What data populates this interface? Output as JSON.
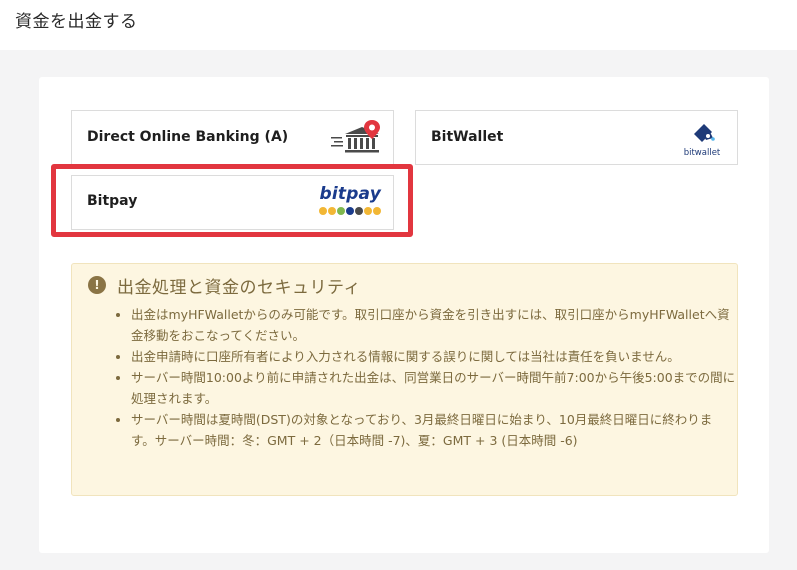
{
  "page": {
    "title": "資金を出金する"
  },
  "methods": [
    {
      "label": "Direct Online Banking (A)",
      "logo": "bank-building-pin-icon"
    },
    {
      "label": "BitWallet",
      "logo": "bitwallet-logo",
      "logo_text": "bitwallet"
    },
    {
      "label": "Bitpay",
      "logo": "bitpay-logo",
      "logo_text": "bitpay",
      "highlighted": true
    }
  ],
  "notice": {
    "title": "出金処理と資金のセキュリティ",
    "items": [
      "出金はmyHFWalletからのみ可能です。取引口座から資金を引き出すには、取引口座からmyHFWalletへ資金移動をおこなってください。",
      "出金申請時に口座所有者により入力される情報に関する誤りに関しては当社は責任を負いません。",
      "サーバー時間10:00より前に申請された出金は、同営業日のサーバー時間午前7:00から午後5:00までの間に処理されます。",
      "サーバー時間は夏時間(DST)の対象となっており、3月最終日曜日に始まり、10月最終日曜日に終わります。サーバー時間：冬：GMT + 2（日本時間 -7)、夏：GMT + 3 (日本時間 -6)"
    ]
  },
  "colors": {
    "highlight": "#e2363f",
    "notice_bg": "#fdf6e1",
    "notice_text": "#7c6a3e",
    "bitpay_blue": "#1a3b8c"
  }
}
